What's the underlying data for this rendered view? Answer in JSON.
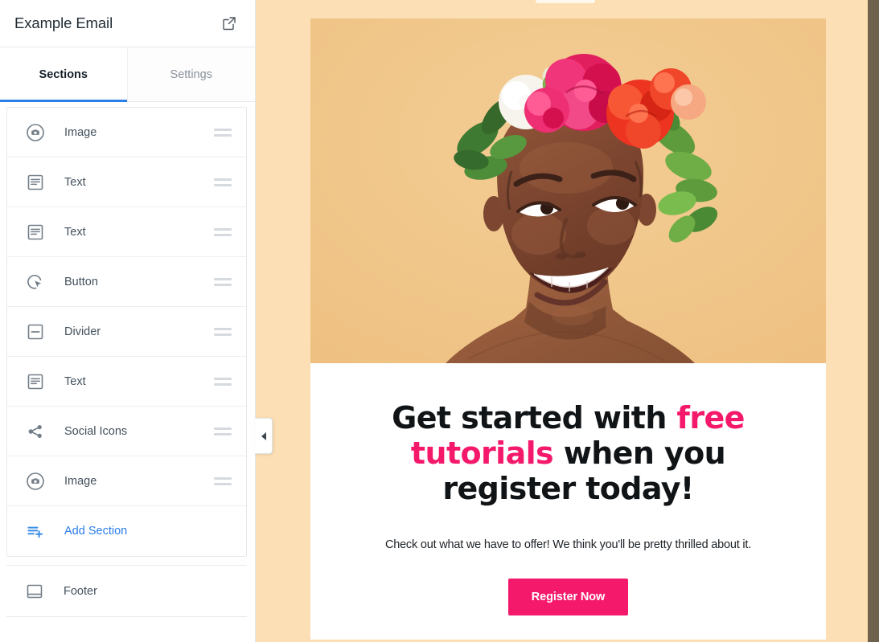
{
  "sidebar": {
    "title": "Example Email",
    "external_link_icon": "external-link-icon",
    "tabs": [
      {
        "label": "Sections",
        "active": true
      },
      {
        "label": "Settings",
        "active": false
      }
    ],
    "sections": [
      {
        "label": "Image",
        "icon": "camera-circle-icon"
      },
      {
        "label": "Text",
        "icon": "text-block-icon"
      },
      {
        "label": "Text",
        "icon": "text-block-icon"
      },
      {
        "label": "Button",
        "icon": "button-cursor-icon"
      },
      {
        "label": "Divider",
        "icon": "divider-icon"
      },
      {
        "label": "Text",
        "icon": "text-block-icon"
      },
      {
        "label": "Social Icons",
        "icon": "share-nodes-icon"
      },
      {
        "label": "Image",
        "icon": "camera-circle-icon"
      }
    ],
    "add_section": {
      "label": "Add Section",
      "icon": "add-section-icon"
    },
    "footer": {
      "label": "Footer",
      "icon": "footer-layout-icon"
    },
    "drag_handle_icon": "drag-handle-icon",
    "accent_color": "#2b7de9"
  },
  "canvas": {
    "background_color": "#fcdfb4",
    "collapse_handle_icon": "chevron-left-icon"
  },
  "email": {
    "hero_image": {
      "alt": "smiling woman wearing a flower crown",
      "background_color": "#f0c78a"
    },
    "heading": {
      "part1": "Get started with ",
      "highlight1": "free tutorials",
      "part2": " when you register today!",
      "highlight_color": "#f5196b"
    },
    "body_text": "Check out what we have to offer! We think you'll be pretty thrilled about it.",
    "cta": {
      "label": "Register Now",
      "background_color": "#f5196b",
      "text_color": "#ffffff"
    }
  }
}
